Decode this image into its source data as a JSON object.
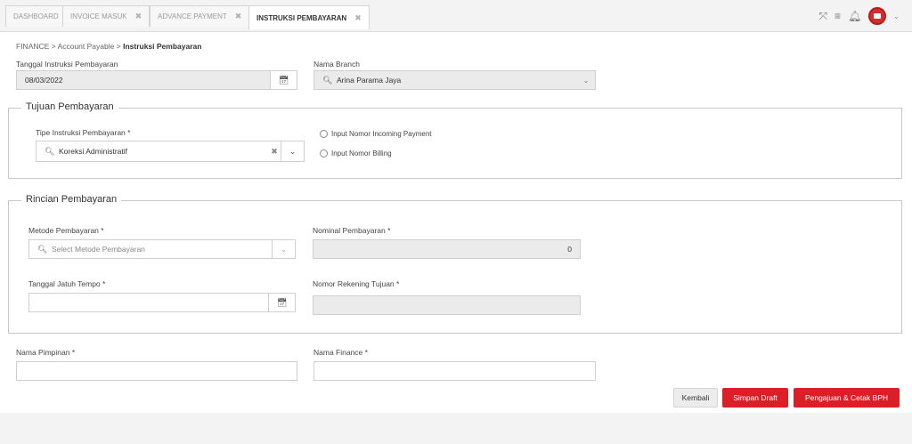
{
  "tabs": [
    {
      "label": "DASHBOARD",
      "closable": false
    },
    {
      "label": "INVOICE MASUK",
      "closable": true
    },
    {
      "label": "ADVANCE PAYMENT",
      "closable": true
    },
    {
      "label": "INSTRUKSI PEMBAYARAN",
      "closable": true,
      "active": true
    }
  ],
  "top_icons": [
    "expand-icon",
    "menu-icon",
    "bell-icon",
    "avatar",
    "chevron-down-icon"
  ],
  "breadcrumb": {
    "part1": "FINANCE",
    "sep": ">",
    "part2": "Account Payable",
    "current": "Instruksi Pembayaran"
  },
  "header_fields": {
    "tanggal_label": "Tanggal Instruksi Pembayaran",
    "tanggal_value": "08/03/2022",
    "branch_label": "Nama Branch",
    "branch_value": "Arina Parama Jaya"
  },
  "tujuan": {
    "legend": "Tujuan Pembayaran",
    "tipe_label": "Tipe Instruksi Pembayaran *",
    "tipe_value": "Koreksi Administratif",
    "radio1": "Input Nomor Incoming Payment",
    "radio2": "Input Nomor Billing"
  },
  "rincian": {
    "legend": "Rincian Pembayaran",
    "metode_label": "Metode Pembayaran *",
    "metode_placeholder": "Select Metode Pembayaran",
    "nominal_label": "Nominal Pembayaran *",
    "nominal_value": "0",
    "jatuh_tempo_label": "Tanggal Jatuh Tempo *",
    "rekening_label": "Nomor Rekening Tujuan *"
  },
  "footer_fields": {
    "pimpinan_label": "Nama Pimpinan *",
    "finance_label": "Nama Finance *"
  },
  "buttons": {
    "kembali": "Kembali",
    "simpan": "Simpan Draft",
    "pengajuan": "Pengajuan & Cetak BPH"
  },
  "colors": {
    "accent": "#dc1f26"
  }
}
